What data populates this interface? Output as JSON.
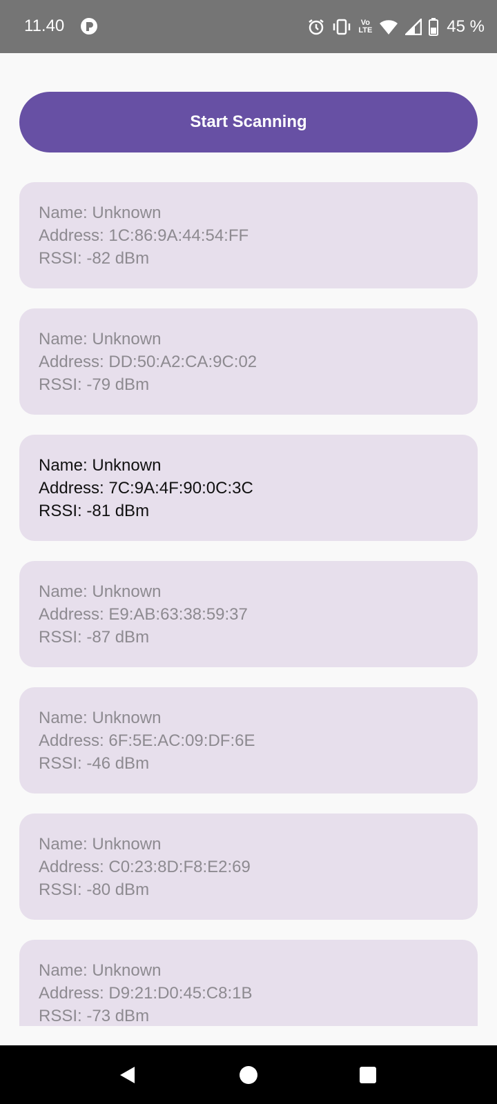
{
  "status_bar": {
    "time": "11.40",
    "lte_top": "Vo",
    "lte_bottom": "LTE",
    "battery": "45 %"
  },
  "scan_button_label": "Start Scanning",
  "devices": [
    {
      "name": "Name: Unknown",
      "address": "Address: 1C:86:9A:44:54:FF",
      "rssi": "RSSI: -82 dBm"
    },
    {
      "name": "Name: Unknown",
      "address": "Address: DD:50:A2:CA:9C:02",
      "rssi": "RSSI: -79 dBm"
    },
    {
      "name": "Name: Unknown",
      "address": "Address: 7C:9A:4F:90:0C:3C",
      "rssi": "RSSI: -81 dBm"
    },
    {
      "name": "Name: Unknown",
      "address": "Address: E9:AB:63:38:59:37",
      "rssi": "RSSI: -87 dBm"
    },
    {
      "name": "Name: Unknown",
      "address": "Address: 6F:5E:AC:09:DF:6E",
      "rssi": "RSSI: -46 dBm"
    },
    {
      "name": "Name: Unknown",
      "address": "Address: C0:23:8D:F8:E2:69",
      "rssi": "RSSI: -80 dBm"
    },
    {
      "name": "Name: Unknown",
      "address": "Address: D9:21:D0:45:C8:1B",
      "rssi": "RSSI: -73 dBm"
    }
  ],
  "colors": {
    "accent": "#6750a4",
    "card": "#e7dfec",
    "status_bar": "#757575",
    "nav_bar": "#000000"
  },
  "icons": [
    "app-notification-icon",
    "alarm-icon",
    "vibrate-icon",
    "wifi-icon",
    "signal-icon",
    "battery-icon",
    "back-icon",
    "home-icon",
    "recents-icon"
  ]
}
